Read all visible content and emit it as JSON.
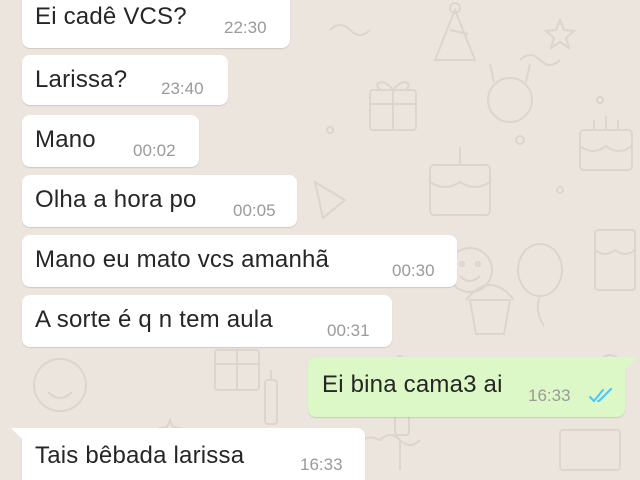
{
  "colors": {
    "chat_background": "#ece5dd",
    "incoming_bubble": "#ffffff",
    "outgoing_bubble": "#dcf8c6",
    "timestamp": "#9a9a9a",
    "read_ticks": "#4fc3f7"
  },
  "messages": [
    {
      "direction": "incoming",
      "text": "Ei cadê VCS?",
      "time": "22:30"
    },
    {
      "direction": "incoming",
      "text": "Larissa?",
      "time": "23:40"
    },
    {
      "direction": "incoming",
      "text": "Mano",
      "time": "00:02"
    },
    {
      "direction": "incoming",
      "text": "Olha a hora po",
      "time": "00:05"
    },
    {
      "direction": "incoming",
      "text": "Mano eu mato vcs amanhã",
      "time": "00:30"
    },
    {
      "direction": "incoming",
      "text": "A sorte é q n tem aula",
      "time": "00:31"
    },
    {
      "direction": "outgoing",
      "text": "Ei bina cama3 ai",
      "time": "16:33",
      "status_icon": "double-check-read-icon"
    },
    {
      "direction": "incoming",
      "text": "Tais bêbada larissa",
      "time": "16:33"
    }
  ]
}
